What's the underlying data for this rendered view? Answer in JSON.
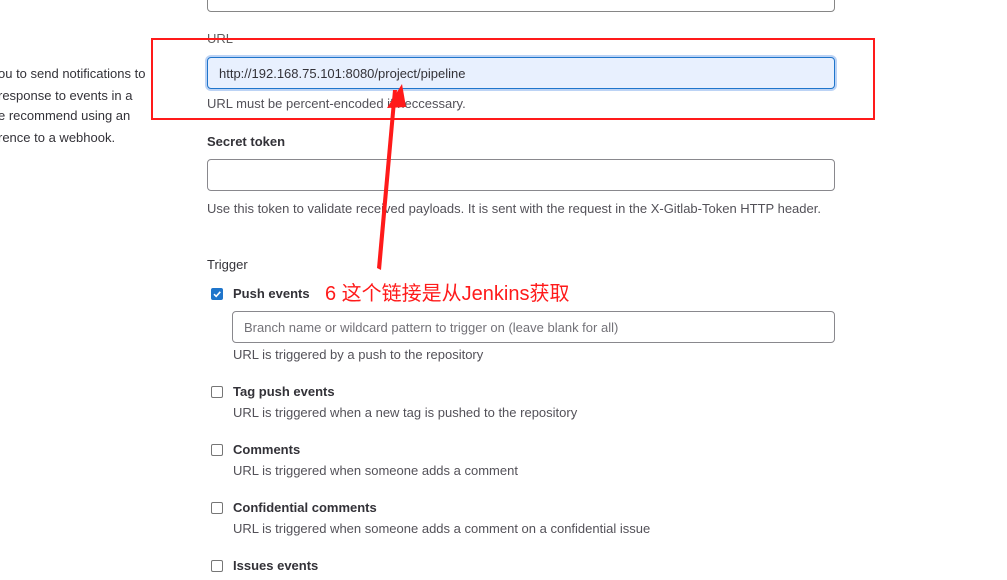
{
  "left_description": {
    "lines": [
      "ou to send notifications to",
      "response to events in a",
      "e recommend using an",
      "rence to a webhook."
    ]
  },
  "url_field": {
    "label": "URL",
    "value": "http://192.168.75.101:8080/project/pipeline",
    "help": "URL must be percent-encoded if neccessary."
  },
  "secret_token": {
    "label": "Secret token",
    "value": "",
    "help": "Use this token to validate received payloads. It is sent with the request in the X-Gitlab-Token HTTP header."
  },
  "trigger": {
    "label": "Trigger",
    "items": [
      {
        "label": "Push events",
        "checked": true,
        "help": "URL is triggered by a push to the repository",
        "branch_placeholder": "Branch name or wildcard pattern to trigger on (leave blank for all)"
      },
      {
        "label": "Tag push events",
        "checked": false,
        "help": "URL is triggered when a new tag is pushed to the repository"
      },
      {
        "label": "Comments",
        "checked": false,
        "help": "URL is triggered when someone adds a comment"
      },
      {
        "label": "Confidential comments",
        "checked": false,
        "help": "URL is triggered when someone adds a comment on a confidential issue"
      },
      {
        "label": "Issues events",
        "checked": false,
        "help": ""
      }
    ]
  },
  "annotation": {
    "text": "6 这个链接是从Jenkins获取",
    "color": "#ff1a1a"
  },
  "colors": {
    "accent": "#1f75cb",
    "annotation_red": "#ff1a1a"
  }
}
